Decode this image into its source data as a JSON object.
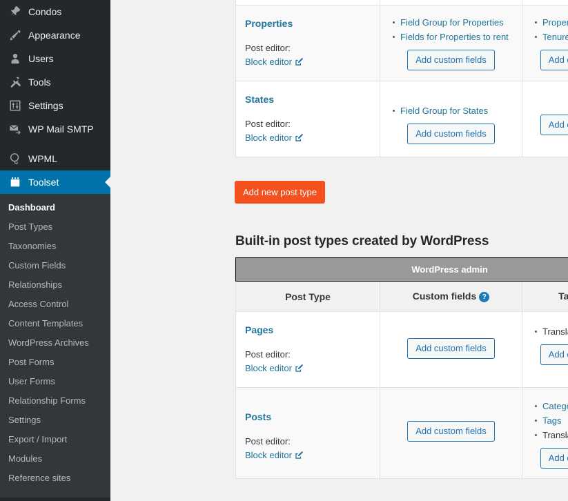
{
  "sidebar": {
    "menu": [
      {
        "label": "Condos",
        "icon": "pin-icon",
        "current": false
      },
      {
        "label": "Appearance",
        "icon": "paintbrush-icon",
        "current": false
      },
      {
        "label": "Users",
        "icon": "user-icon",
        "current": false
      },
      {
        "label": "Tools",
        "icon": "wrench-icon",
        "current": false
      },
      {
        "label": "Settings",
        "icon": "sliders-icon",
        "current": false
      },
      {
        "label": "WP Mail SMTP",
        "icon": "envelope-arrow-icon",
        "current": false
      },
      {
        "label": "WPML",
        "icon": "globe-icon",
        "current": false
      },
      {
        "label": "Toolset",
        "icon": "calendar-icon",
        "current": true
      }
    ],
    "submenu": [
      {
        "label": "Dashboard",
        "active": true
      },
      {
        "label": "Post Types",
        "active": false
      },
      {
        "label": "Taxonomies",
        "active": false
      },
      {
        "label": "Custom Fields",
        "active": false
      },
      {
        "label": "Relationships",
        "active": false
      },
      {
        "label": "Access Control",
        "active": false
      },
      {
        "label": "Content Templates",
        "active": false
      },
      {
        "label": "WordPress Archives",
        "active": false
      },
      {
        "label": "Post Forms",
        "active": false
      },
      {
        "label": "User Forms",
        "active": false
      },
      {
        "label": "Relationship Forms",
        "active": false
      },
      {
        "label": "Settings",
        "active": false
      },
      {
        "label": "Export / Import",
        "active": false
      },
      {
        "label": "Modules",
        "active": false
      },
      {
        "label": "Reference sites",
        "active": false
      }
    ]
  },
  "main": {
    "custom_post_types_table": {
      "rows": [
        {
          "post_type": "Properties",
          "editor_label": "Post editor:",
          "editor_link": "Block editor",
          "custom_fields": [
            "Field Group for Properties",
            "Fields for Properties to rent"
          ],
          "custom_fields_button": "Add custom fields",
          "taxonomies": [
            "Property types",
            "Tenure"
          ],
          "taxonomies_button": "Add custom taxonomy"
        },
        {
          "post_type": "States",
          "editor_label": "Post editor:",
          "editor_link": "Block editor",
          "custom_fields": [
            "Field Group for States"
          ],
          "custom_fields_button": "Add custom fields",
          "taxonomies": [],
          "taxonomies_button": "Add custom taxonomy"
        }
      ]
    },
    "add_new_post_type_button": "Add new post type",
    "builtin_section_title": "Built-in post types created by WordPress",
    "builtin_table": {
      "group_header": "WordPress admin",
      "columns": [
        "Post Type",
        "Custom fields",
        "Taxonomies"
      ],
      "help_glyph": "?",
      "rows": [
        {
          "post_type": "Pages",
          "editor_label": "Post editor:",
          "editor_link": "Block editor",
          "custom_fields": [],
          "custom_fields_button": "Add custom fields",
          "taxonomies": [
            "Translation Priorities"
          ],
          "taxonomies_button": "Add custom taxonomy"
        },
        {
          "post_type": "Posts",
          "editor_label": "Post editor:",
          "editor_link": "Block editor",
          "custom_fields": [],
          "custom_fields_button": "Add custom fields",
          "taxonomies": [
            "Categories",
            "Tags",
            "Translation Priorities"
          ],
          "taxonomies_button": "Add custom taxonomy"
        }
      ]
    }
  },
  "colors": {
    "sidebar_bg": "#23282d",
    "submenu_bg": "#32373c",
    "current_menu": "#0073aa",
    "link_blue": "#21759b",
    "button_orange": "#f4511e",
    "group_header_gray": "#999999"
  }
}
